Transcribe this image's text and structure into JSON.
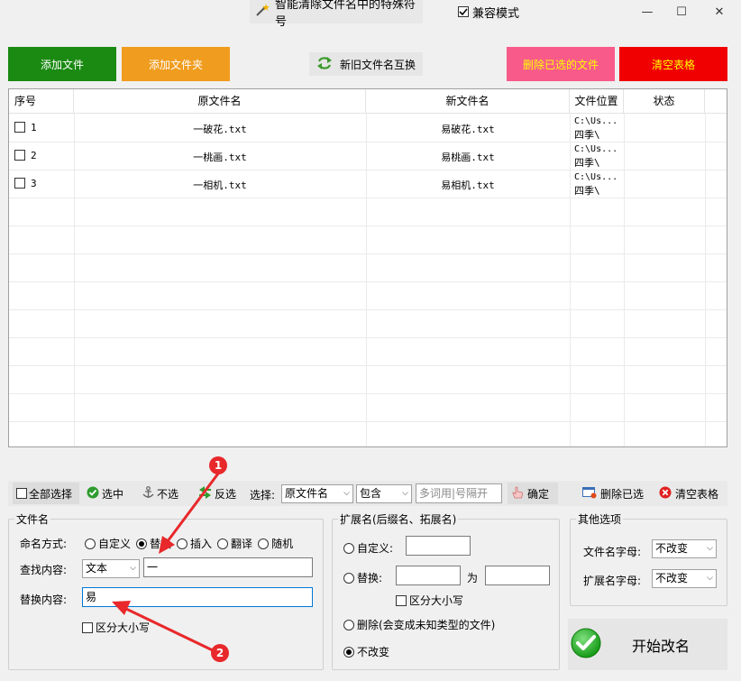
{
  "titlebar": {
    "app_title": "智能清除文件名中的特殊符号",
    "compat_label": "兼容模式",
    "compat_checked": true,
    "minimize": "—",
    "maximize": "☐",
    "close": "✕"
  },
  "toolbar": {
    "add_file": "添加文件",
    "add_folder": "添加文件夹",
    "swap_names": "新旧文件名互换",
    "delete_selected": "删除已选的文件",
    "clear_table": "清空表格"
  },
  "colors": {
    "add_file_bg": "#1a8a12",
    "add_folder_bg": "#f09c1e",
    "delete_selected_bg": "#f85a8a",
    "delete_selected_text": "#ffff00",
    "clear_table_bg": "#f00000",
    "clear_table_text": "#ffff00",
    "arrow": "#e8282b"
  },
  "table": {
    "columns": [
      "序号",
      "原文件名",
      "新文件名",
      "文件位置",
      "状态"
    ],
    "rows": [
      {
        "index": "1",
        "old": "一破花.txt",
        "new": "易破花.txt",
        "loc1": "C:\\Us...",
        "loc2": "四季\\",
        "status": ""
      },
      {
        "index": "2",
        "old": "一桃画.txt",
        "new": "易桃画.txt",
        "loc1": "C:\\Us...",
        "loc2": "四季\\",
        "status": ""
      },
      {
        "index": "3",
        "old": "一相机.txt",
        "new": "易相机.txt",
        "loc1": "C:\\Us...",
        "loc2": "四季\\",
        "status": ""
      }
    ]
  },
  "selection_bar": {
    "select_all": "全部选择",
    "check": "选中",
    "uncheck": "不选",
    "invert": "反选",
    "select_label": "选择:",
    "field_value": "原文件名",
    "mode_value": "包含",
    "keyword_placeholder": "多词用|号隔开",
    "confirm": "确定",
    "delete_selected": "删除已选",
    "clear_table": "清空表格"
  },
  "filename_group": {
    "legend": "文件名",
    "naming_label": "命名方式:",
    "modes": [
      "自定义",
      "替换",
      "插入",
      "翻译",
      "随机"
    ],
    "selected_mode": "替换",
    "find_label": "查找内容:",
    "find_type": "文本",
    "find_value": "一",
    "replace_label": "替换内容:",
    "replace_value": "易",
    "case_sensitive": "区分大小写"
  },
  "ext_group": {
    "legend": "扩展名(后缀名、拓展名)",
    "custom": "自定义:",
    "replace": "替换:",
    "to": "为",
    "case_sensitive": "区分大小写",
    "delete": "删除(会变成未知类型的文件)",
    "unchanged": "不改变",
    "selected": "不改变"
  },
  "other_group": {
    "legend": "其他选项",
    "filename_case_label": "文件名字母:",
    "filename_case_value": "不改变",
    "ext_case_label": "扩展名字母:",
    "ext_case_value": "不改变"
  },
  "start_button": "开始改名",
  "annotations": {
    "marker1": "1",
    "marker2": "2"
  }
}
